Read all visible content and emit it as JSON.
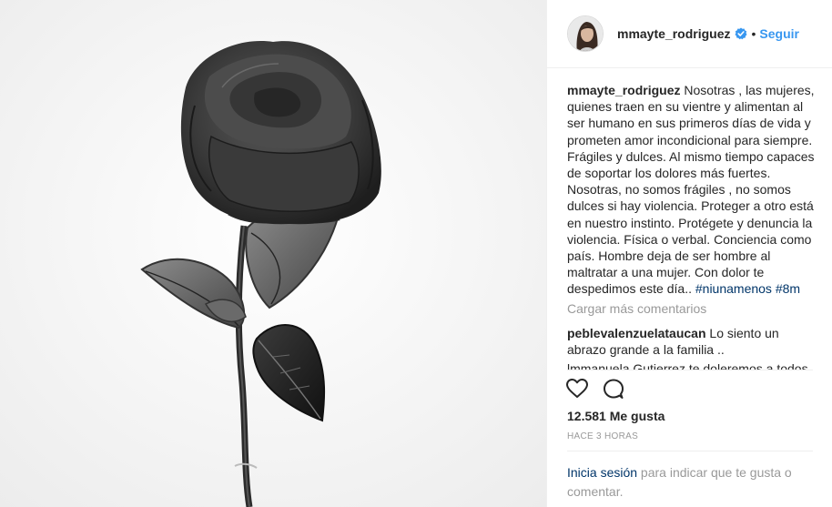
{
  "post": {
    "username": "mmayte_rodriguez",
    "follow_label": "Seguir",
    "dot": "•",
    "verified_icon": "verified-badge",
    "accent_color": "#3897f0"
  },
  "caption": {
    "username": "mmayte_rodriguez",
    "text": "Nosotras , las mujeres, quienes traen en su vientre y alimentan al ser humano en sus primeros días de vida y prometen amor incondicional para siempre. Frágiles y dulces. Al mismo tiempo capaces de soportar los dolores más fuertes. Nosotras, no somos frágiles , no somos dulces si hay violencia. Proteger a otro está en nuestro instinto. Protégete y denuncia la violencia. Física o verbal. Conciencia como país. Hombre deja de ser hombre al maltratar a una mujer. Con dolor te despedimos este día..",
    "hashtags": [
      "#niunamenos",
      "#8m"
    ]
  },
  "load_more_label": "Cargar más comentarios",
  "comments": [
    {
      "username": "peblevalenzuelataucan",
      "text": "Lo siento un abrazo grande a la familia .."
    }
  ],
  "cut_comment_text": "lmmanuela Gutierrez te doleremos a todos",
  "actions": {
    "like_icon": "heart-icon",
    "comment_icon": "comment-icon"
  },
  "likes": "12.581 Me gusta",
  "timestamp": "HACE 3 HORAS",
  "login_prompt": {
    "link": "Inicia sesión",
    "text": " para indicar que te gusta o comentar."
  }
}
